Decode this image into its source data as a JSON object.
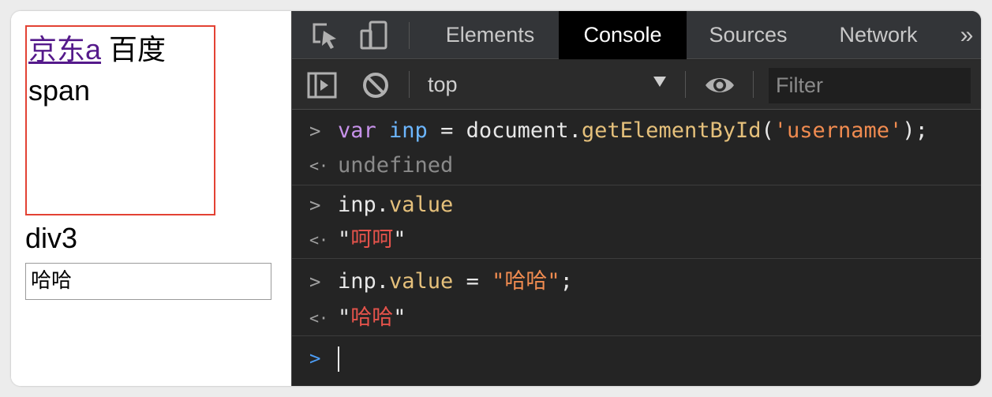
{
  "page": {
    "link_text": "京东a",
    "text_baidu": "百度",
    "span_text": "span",
    "div3_text": "div3",
    "input_value": "哈哈"
  },
  "devtools": {
    "tabs": [
      {
        "label": "Elements",
        "active": false
      },
      {
        "label": "Console",
        "active": true
      },
      {
        "label": "Sources",
        "active": false
      },
      {
        "label": "Network",
        "active": false
      }
    ],
    "more_tabs_glyph": "»",
    "context": "top",
    "filter_placeholder": "Filter"
  },
  "console": {
    "entries": [
      {
        "input": {
          "t1": "var",
          "t2": " ",
          "t3": "inp",
          "t4": " = document.",
          "t5": "getElementById",
          "t6": "(",
          "t7": "'username'",
          "t8": ");"
        },
        "result": "undefined"
      },
      {
        "input": {
          "t1": "inp.",
          "t2": "value"
        },
        "result": {
          "q1": "\"",
          "val": "呵呵",
          "q2": "\""
        }
      },
      {
        "input": {
          "t1": "inp.",
          "t2": "value",
          "t3": " = ",
          "t4": "\"哈哈\"",
          "t5": ";"
        },
        "result": {
          "q1": "\"",
          "val": "哈哈",
          "q2": "\""
        }
      }
    ]
  },
  "colors": {
    "accent_prompt": "#4d9df5",
    "box_border": "#e34234",
    "string": "#f08b50",
    "result_string": "#e5534b"
  },
  "icons": [
    "inspect-element-icon",
    "device-toolbar-icon",
    "sidebar-toggle-icon",
    "clear-console-icon",
    "eye-icon",
    "dropdown-caret-icon",
    "prompt-chevron-icon",
    "result-arrow-icon"
  ]
}
